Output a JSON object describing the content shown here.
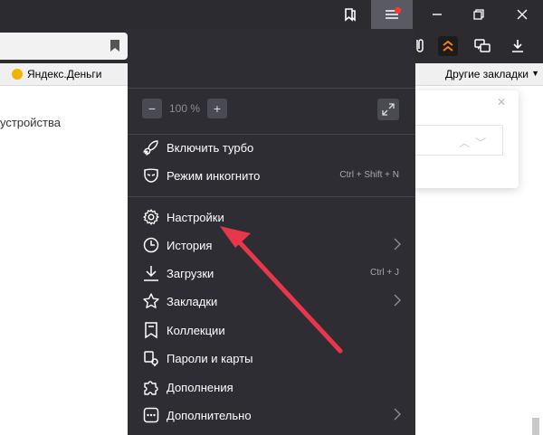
{
  "bookmarks": {
    "item1": "Яндекс.Деньги",
    "other": "Другие закладки"
  },
  "page": {
    "fragment": "устройства"
  },
  "menu": {
    "zoom": {
      "minus": "−",
      "value": "100 %",
      "plus": "+"
    },
    "items": [
      {
        "label": "Включить турбо",
        "icon": "rocket-icon",
        "shortcut": ""
      },
      {
        "label": "Режим инкогнито",
        "icon": "incognito-mask-icon",
        "shortcut": "Ctrl + Shift + N"
      },
      {
        "label": "Настройки",
        "icon": "gear-icon",
        "shortcut": ""
      },
      {
        "label": "История",
        "icon": "clock-icon",
        "shortcut": ""
      },
      {
        "label": "Загрузки",
        "icon": "download-icon",
        "shortcut": "Ctrl + J"
      },
      {
        "label": "Закладки",
        "icon": "star-icon",
        "shortcut": ""
      },
      {
        "label": "Коллекции",
        "icon": "collections-icon",
        "shortcut": ""
      },
      {
        "label": "Пароли и карты",
        "icon": "key-icon",
        "shortcut": ""
      },
      {
        "label": "Дополнения",
        "icon": "puzzle-icon",
        "shortcut": ""
      },
      {
        "label": "Дополнительно",
        "icon": "more-icon",
        "shortcut": ""
      }
    ]
  },
  "colors": {
    "menu_bg": "#2d2d33",
    "titlebar_bg": "#2b2b30",
    "arrow": "#e8364a",
    "notification": "#ff3b30"
  }
}
